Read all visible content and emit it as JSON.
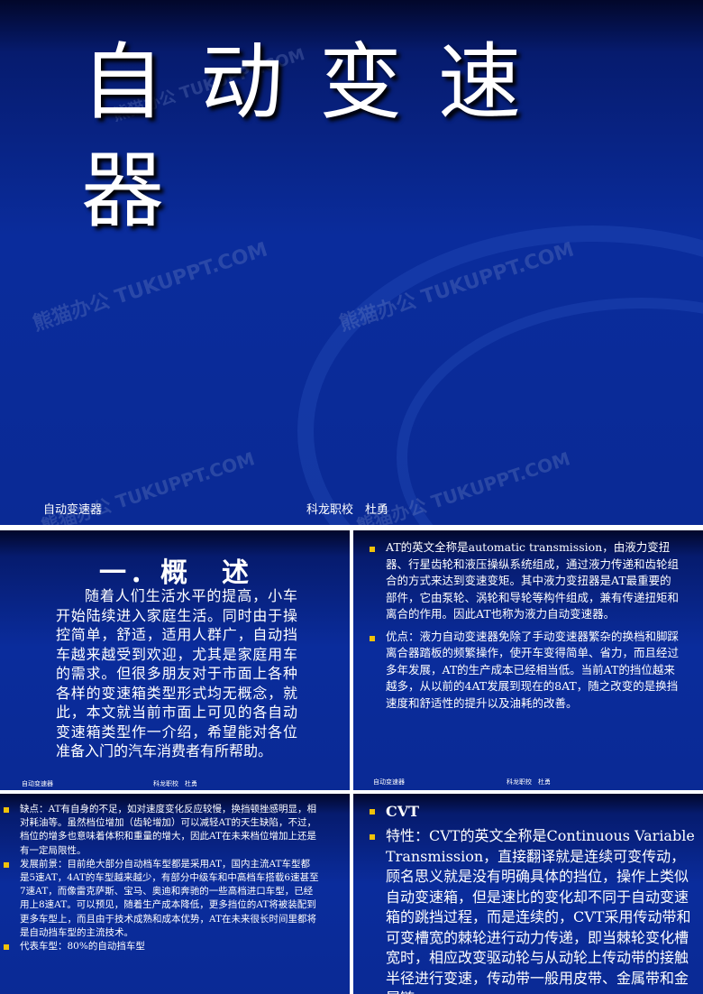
{
  "slide1": {
    "title": "自动变速器",
    "footer_left": "自动变速器",
    "footer_right": "科龙职校　杜勇",
    "watermark": "熊猫办公 TUKUPPT.COM"
  },
  "slide2": {
    "title": "一．概　述",
    "paragraph": "随着人们生活水平的提高，小车开始陆续进入家庭生活。同时由于操控简单，舒适，适用人群广，自动挡车越来越受到欢迎，尤其是家庭用车的需求。但很多朋友对于市面上各种各样的变速箱类型形式均无概念，就此，本文就当前市面上可见的各自动变速箱类型作一介绍，希望能对各位准备入门的汽车消费者有所帮助。",
    "footer_left": "自动变速器",
    "footer_right": "科龙职校　杜勇"
  },
  "slide3": {
    "bullets": [
      "AT的英文全称是automatic transmission，由液力变扭器、行星齿轮和液压操纵系统组成，通过液力传递和齿轮组合的方式来达到变速变矩。其中液力变扭器是AT最重要的部件，它由泵轮、涡轮和导轮等构件组成，兼有传递扭矩和离合的作用。因此AT也称为液力自动变速器。",
      "优点：液力自动变速器免除了手动变速器繁杂的换档和脚踩离合器踏板的频繁操作，使开车变得简单、省力，而且经过多年发展，AT的生产成本已经相当低。当前AT的挡位越来越多，从以前的4AT发展到现在的8AT，随之改变的是换挡速度和舒适性的提升以及油耗的改善。"
    ],
    "footer_left": "自动变速器",
    "footer_right": "科龙职校　杜勇"
  },
  "slide4": {
    "bullets": [
      "缺点：AT有自身的不足，如对速度变化反应较慢，换挡顿挫感明显，相对耗油等。虽然档位增加（齿轮增加）可以减轻AT的天生缺陷，不过，档位的增多也意味着体积和重量的增大，因此AT在未来档位增加上还是有一定局限性。",
      "发展前景：目前绝大部分自动档车型都是采用AT，国内主流AT车型都是5速AT，4AT的车型越来越少，有部分中级车和中高档车搭载6速甚至7速AT，而像雷克萨斯、宝马、奥迪和奔驰的一些高档进口车型，已经用上8速AT。可以预见，随着生产成本降低，更多挡位的AT将被装配到更多车型上，而且由于技术成熟和成本优势，AT在未来很长时间里都将是自动挡车型的主流技术。",
      "代表车型：80%的自动挡车型"
    ]
  },
  "slide5": {
    "heading": "CVT",
    "body": "特性：CVT的英文全称是Continuous Variable Transmission，直接翻译就是连续可变传动，顾名思义就是没有明确具体的挡位，操作上类似自动变速箱，但是速比的变化却不同于自动变速箱的跳挡过程，而是连续的，CVT采用传动带和可变槽宽的棘轮进行动力传递，即当棘轮变化槽宽时，相应改变驱动轮与从动轮上传动带的接触半径进行变速，传动带一般用皮带、金属带和金属链"
  }
}
